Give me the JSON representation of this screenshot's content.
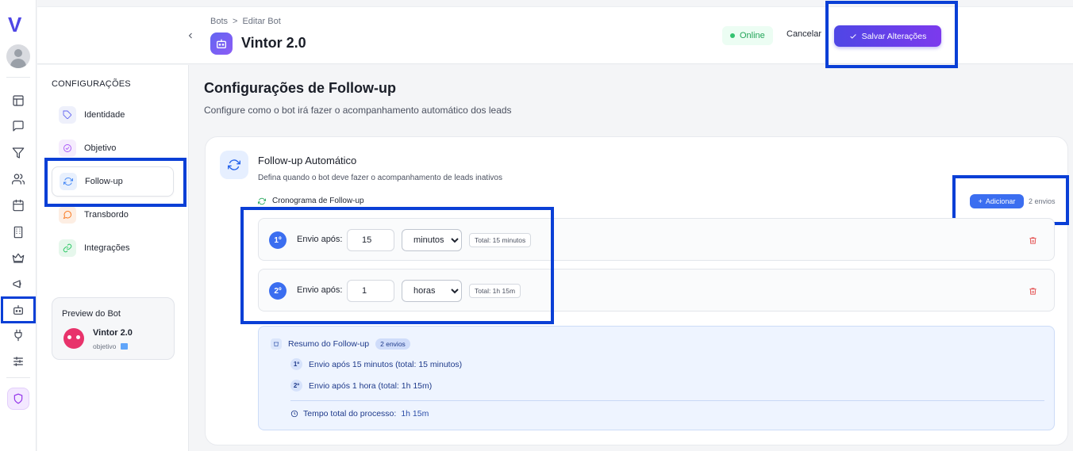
{
  "breadcrumb": {
    "root": "Bots",
    "separator": ">",
    "current": "Editar Bot"
  },
  "header": {
    "bot_name": "Vintor 2.0",
    "status": "Online",
    "cancel_label": "Cancelar",
    "save_label": "Salvar Alterações"
  },
  "logo": "V",
  "sidebar": {
    "title": "CONFIGURAÇÕES",
    "items": [
      {
        "label": "Identidade",
        "icon": "tag-icon",
        "color": "#6366f1",
        "bg": "#eef0fb"
      },
      {
        "label": "Objetivo",
        "icon": "target-icon",
        "color": "#a855f7",
        "bg": "#f5ecfd"
      },
      {
        "label": "Follow-up",
        "icon": "refresh-icon",
        "color": "#3b82f6",
        "bg": "#e8f0fd",
        "active": true
      },
      {
        "label": "Transbordo",
        "icon": "chat-icon",
        "color": "#f97316",
        "bg": "#fdeee3"
      },
      {
        "label": "Integrações",
        "icon": "link-icon",
        "color": "#22c55e",
        "bg": "#e6f7ec"
      }
    ],
    "preview": {
      "title": "Preview do Bot",
      "name": "Vintor 2.0",
      "subtitle": "objetivo"
    }
  },
  "page": {
    "title": "Configurações de Follow-up",
    "subtitle": "Configure como o bot irá fazer o acompanhamento automático dos leads"
  },
  "card": {
    "title": "Follow-up Automático",
    "subtitle": "Defina quando o bot deve fazer o acompanhamento de leads inativos",
    "schedule_label": "Cronograma de Follow-up",
    "add_label": "Adicionar",
    "count_label": "2 envios"
  },
  "steps": [
    {
      "badge": "1º",
      "label": "Envio após:",
      "value": "15",
      "unit": "minutos",
      "total": "Total: 15 minutos"
    },
    {
      "badge": "2º",
      "label": "Envio após:",
      "value": "1",
      "unit": "horas",
      "total": "Total: 1h 15m"
    }
  ],
  "summary": {
    "title": "Resumo do Follow-up",
    "pill": "2 envios",
    "rows": [
      {
        "badge": "1º",
        "text": "Envio após 15 minutos (total: 15 minutos)"
      },
      {
        "badge": "2º",
        "text": "Envio após 1 hora (total: 1h 15m)"
      }
    ],
    "total_label": "Tempo total do processo:",
    "total_value": "1h 15m"
  },
  "colors": {
    "accent": "#4f46e5",
    "primary_blue": "#3b6ef0",
    "highlight": "#0a3fd6",
    "online": "#22a559",
    "danger": "#e34b4b"
  }
}
